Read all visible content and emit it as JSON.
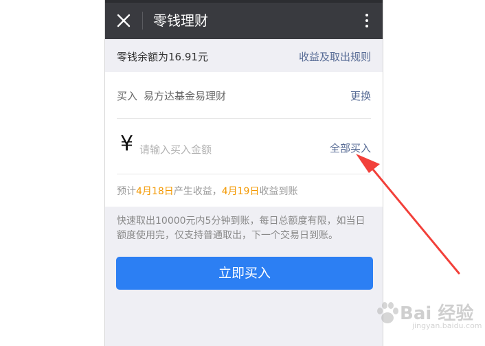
{
  "header": {
    "title": "零钱理财",
    "close_icon": "close-icon",
    "more_icon": "more-vertical-icon"
  },
  "balance": {
    "text": "零钱余额为16.91元",
    "rules_link": "收益及取出规则"
  },
  "purchase": {
    "buy_label": "买入",
    "fund_name": "易方达基金易理财",
    "change_label": "更换",
    "currency_symbol": "¥",
    "amount_placeholder": "请输入买入金额",
    "buy_all_label": "全部买入",
    "estimate": {
      "prefix": "预计",
      "date1": "4月18日",
      "middle": "产生收益，",
      "date2": "4月19日",
      "suffix": "收益到账"
    }
  },
  "note": "快速取出10000元内5分钟到账，每日总额度有限，如当日额度使用完，仅支持普通取出，下一个交易日到账。",
  "buy_button": "立即买入",
  "watermark": {
    "text": "Bai 经验",
    "sub": "jingyan.baidu.com"
  },
  "colors": {
    "header_bg": "#393a3f",
    "link": "#576b95",
    "highlight": "#f39800",
    "primary_button": "#2c7ff3",
    "annotation_arrow": "#f2403a"
  }
}
